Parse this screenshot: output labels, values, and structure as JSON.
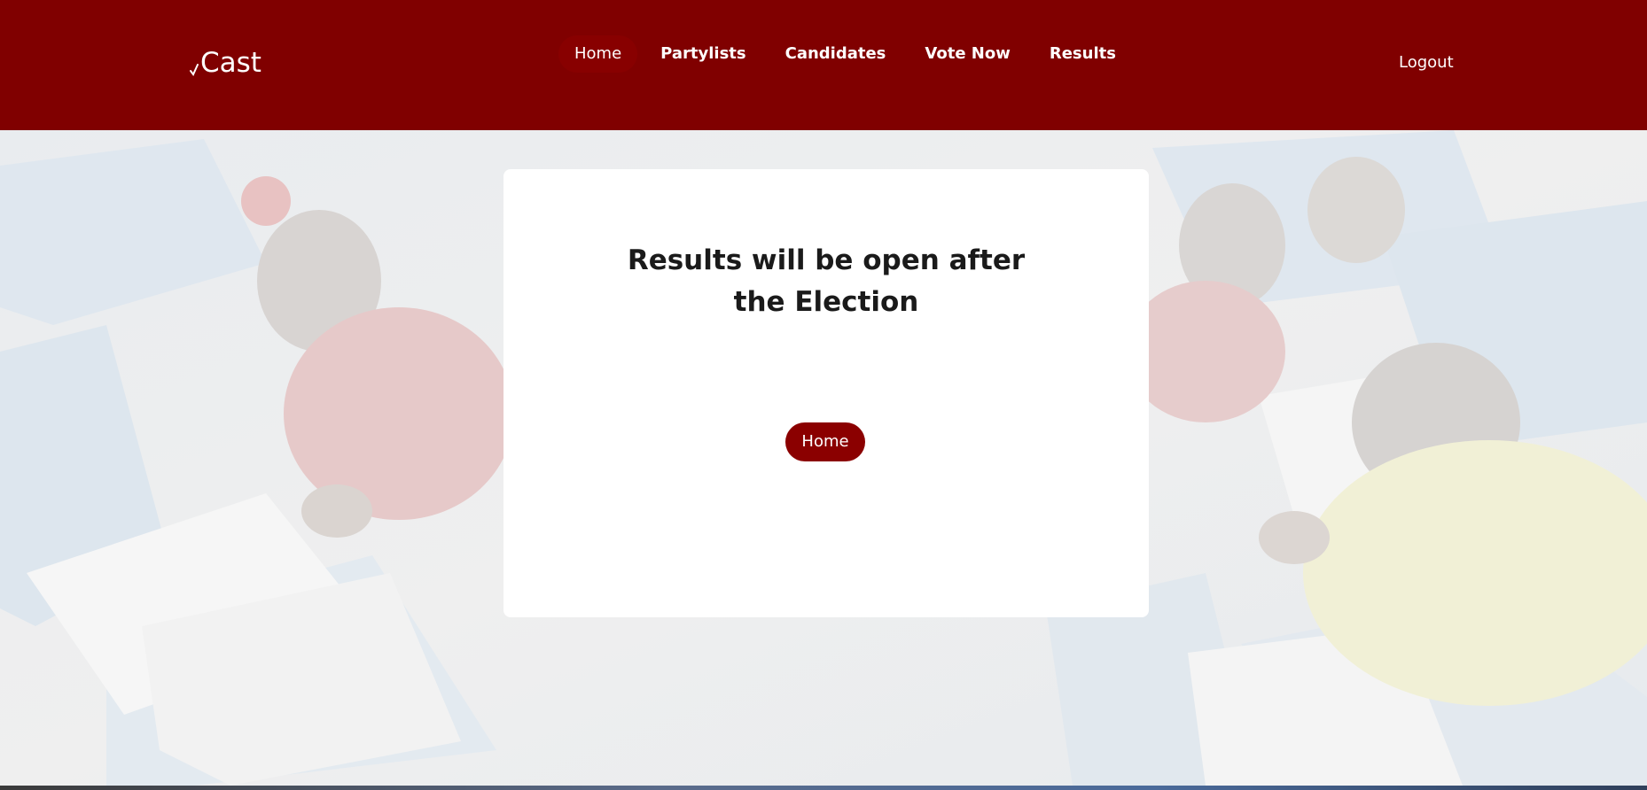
{
  "header": {
    "brand": "Cast",
    "nav": [
      {
        "label": "Home",
        "active": true
      },
      {
        "label": "Partylists",
        "active": false
      },
      {
        "label": "Candidates",
        "active": false
      },
      {
        "label": "Vote Now",
        "active": false
      },
      {
        "label": "Results",
        "active": false
      }
    ],
    "logout_label": "Logout"
  },
  "card": {
    "message": "Results will be open after the Election",
    "home_button_label": "Home"
  },
  "colors": {
    "brand_primary": "#800000",
    "button": "#8b0000",
    "card_background": "#ffffff"
  }
}
